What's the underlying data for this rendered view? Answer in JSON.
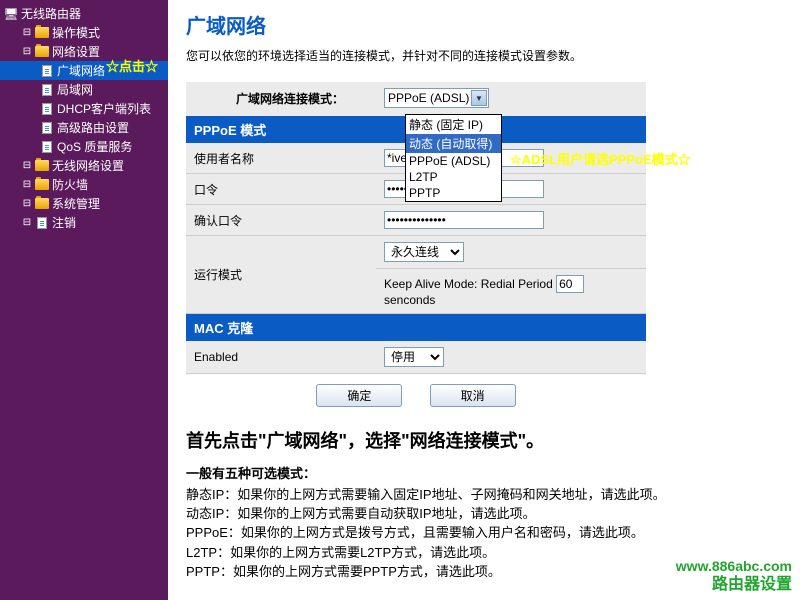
{
  "sidebar": {
    "root": "无线路由器",
    "items": [
      {
        "label": "操作模式",
        "type": "folder"
      },
      {
        "label": "网络设置",
        "type": "folder",
        "children": [
          {
            "label": "广域网络",
            "selected": true
          },
          {
            "label": "局域网"
          },
          {
            "label": "DHCP客户端列表"
          },
          {
            "label": "高级路由设置"
          },
          {
            "label": "QoS 质量服务"
          }
        ]
      },
      {
        "label": "无线网络设置",
        "type": "folder"
      },
      {
        "label": "防火墙",
        "type": "folder"
      },
      {
        "label": "系统管理",
        "type": "folder"
      },
      {
        "label": "注销",
        "type": "page"
      }
    ]
  },
  "callouts": {
    "click": "☆点击☆",
    "adsl": "☆ADSL用户请选PPPoE模式☆"
  },
  "page": {
    "title": "广域网络",
    "desc": "您可以依您的环境选择适当的连接模式，并针对不同的连接模式设置参数。"
  },
  "form": {
    "conn_mode_label": "广域网络连接模式：",
    "conn_mode_value": "PPPoE (ADSL)",
    "dropdown": [
      "静态 (固定 IP)",
      "动态 (自动取得)",
      "PPPoE (ADSL)",
      "L2TP",
      "PPTP"
    ],
    "dropdown_hl_index": 1,
    "section_pppoe": "PPPoE 模式",
    "username_label": "使用者名称",
    "username_value": "*ivers",
    "password_label": "口令",
    "password_value": "••••••••••••••",
    "confirm_label": "确认口令",
    "confirm_value": "••••••••••••••",
    "runmode_label": "运行模式",
    "runmode_value": "永久连线",
    "keepalive_prefix": "Keep Alive Mode: Redial Period",
    "keepalive_value": "60",
    "keepalive_suffix": "senconds",
    "section_mac": "MAC 克隆",
    "enabled_label": "Enabled",
    "enabled_value": "停用"
  },
  "buttons": {
    "ok": "确定",
    "cancel": "取消"
  },
  "guide": {
    "title": "首先点击\"广域网络\"，选择\"网络连接模式\"。",
    "sub": "一般有五种可选模式：",
    "lines": [
      "静态IP：如果你的上网方式需要输入固定IP地址、子网掩码和网关地址，请选此项。",
      "动态IP：如果你的上网方式需要自动获取IP地址，请选此项。",
      "PPPoE：如果你的上网方式是拨号方式，且需要输入用户名和密码，请选此项。",
      "L2TP：如果你的上网方式需要L2TP方式，请选此项。",
      "PPTP：如果你的上网方式需要PPTP方式，请选此项。"
    ]
  },
  "watermark": {
    "url": "www.886abc.com",
    "text": "路由器设置"
  }
}
